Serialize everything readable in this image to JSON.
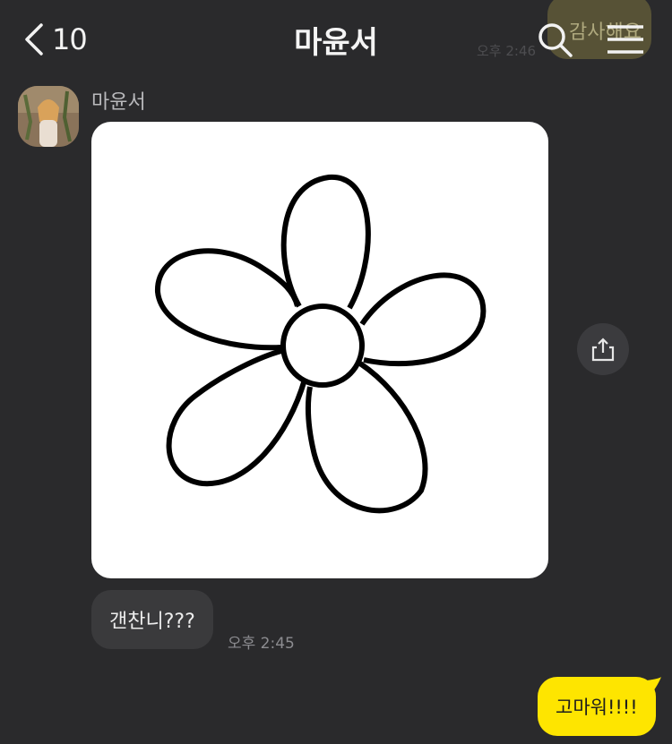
{
  "header": {
    "back_count": "10",
    "title": "마윤서",
    "background_bubble_text": "감사해요",
    "background_bubble_time": "오후 2:46"
  },
  "icons": {
    "back": "chevron-left-icon",
    "search": "search-icon",
    "menu": "hamburger-menu-icon",
    "share": "share-upload-icon"
  },
  "messages": [
    {
      "sender": "마윤서",
      "type": "image",
      "content": "flower line drawing"
    },
    {
      "sender": "마윤서",
      "type": "text",
      "text": "갠찬니???",
      "time": "오후 2:45"
    },
    {
      "sender": "me",
      "type": "text",
      "text": "고마워!!!!"
    }
  ],
  "colors": {
    "background": "#2a2a2c",
    "incoming_bubble": "#3a3a3c",
    "outgoing_bubble": "#fee500"
  }
}
